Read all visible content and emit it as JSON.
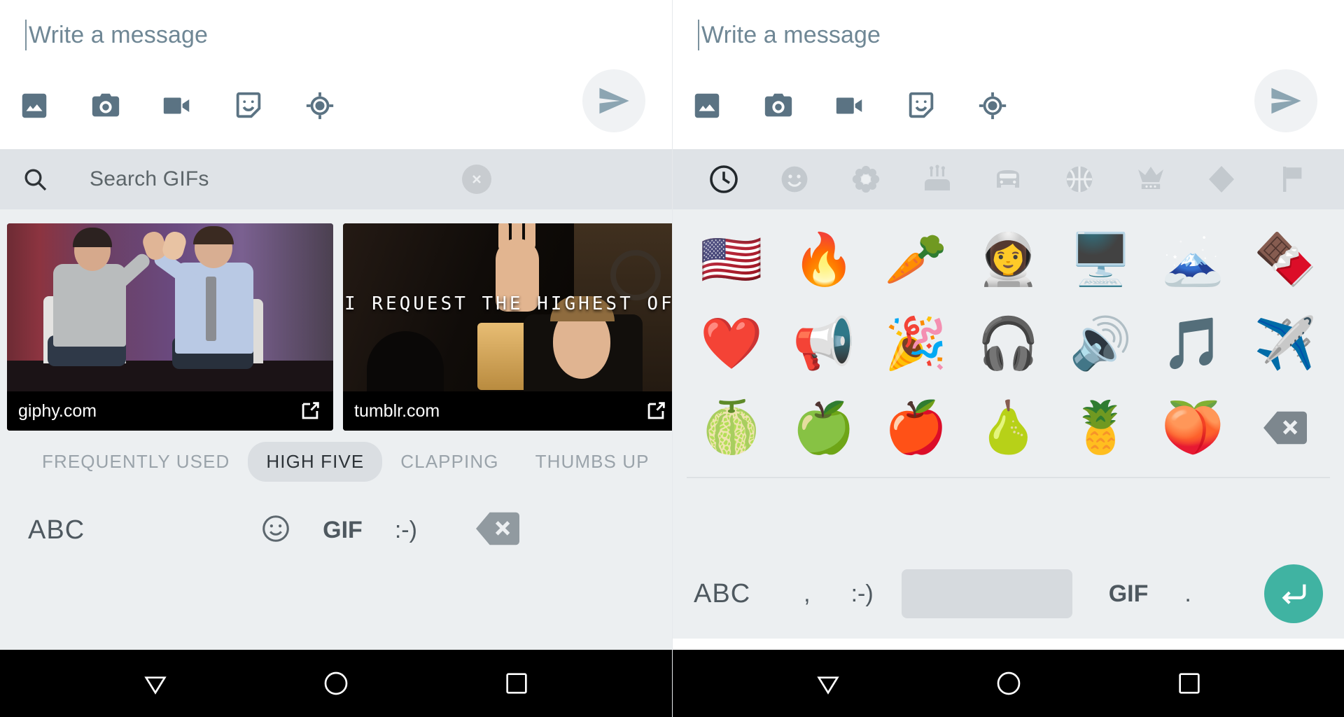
{
  "compose": {
    "placeholder": "Write a message",
    "actions": [
      {
        "name": "gallery-icon",
        "label": "Gallery"
      },
      {
        "name": "camera-icon",
        "label": "Camera"
      },
      {
        "name": "video-camera-icon",
        "label": "Video"
      },
      {
        "name": "sticker-icon",
        "label": "Sticker"
      },
      {
        "name": "location-icon",
        "label": "Location"
      }
    ],
    "send_label": "Send"
  },
  "gif_panel": {
    "search_placeholder": "Search GIFs",
    "clear_label": "Clear",
    "results": [
      {
        "source": "giphy.com",
        "caption": ""
      },
      {
        "source": "tumblr.com",
        "caption": "I REQUEST THE HIGHEST OF FIVES"
      }
    ],
    "categories": [
      {
        "label": "FREQUENTLY USED",
        "active": false
      },
      {
        "label": "HIGH FIVE",
        "active": true
      },
      {
        "label": "CLAPPING",
        "active": false
      },
      {
        "label": "THUMBS UP",
        "active": false
      }
    ]
  },
  "left_keyboard": {
    "abc_label": "ABC",
    "emoji_label": "emoji-face",
    "gif_label": "GIF",
    "kaomoji_label": ":-)",
    "backspace_label": "Backspace"
  },
  "emoji_panel": {
    "tabs": [
      {
        "name": "recent-clock-icon",
        "active": true
      },
      {
        "name": "smiley-icon",
        "active": false
      },
      {
        "name": "flower-icon",
        "active": false
      },
      {
        "name": "cake-icon",
        "active": false
      },
      {
        "name": "car-icon",
        "active": false
      },
      {
        "name": "basketball-icon",
        "active": false
      },
      {
        "name": "crown-icon",
        "active": false
      },
      {
        "name": "diamond-icon",
        "active": false
      },
      {
        "name": "flag-icon",
        "active": false
      }
    ],
    "emojis": [
      "🇺🇸",
      "🔥",
      "🥕",
      "👩‍🚀",
      "🖥️",
      "🗻",
      "🍫",
      "❤️",
      "📢",
      "🎉",
      "🎧",
      "🔊",
      "🎵",
      "✈️",
      "🍈",
      "🍏",
      "🍎",
      "🍐",
      "🍍",
      "🍑"
    ],
    "emoji_names": [
      "flag-united-states",
      "fire",
      "carrot",
      "astronaut",
      "desktop-computer",
      "mount-fuji",
      "chocolate-bar",
      "heart",
      "megaphone",
      "party-popper",
      "headphone",
      "speaker",
      "musical-note",
      "airplane",
      "melon",
      "green-apple",
      "red-apple",
      "pear",
      "pineapple",
      "peach"
    ],
    "backspace_label": "Backspace"
  },
  "right_keyboard": {
    "abc_label": "ABC",
    "comma_label": ",",
    "kaomoji_label": ":-)",
    "space_label": "",
    "gif_label": "GIF",
    "period_label": ".",
    "enter_label": "Enter"
  },
  "navbar": {
    "back_label": "Back",
    "home_label": "Home",
    "recents_label": "Recents"
  },
  "colors": {
    "icon_slate": "#5b7383",
    "panel_bg": "#eceff1",
    "bar_bg": "#dfe3e7",
    "accent_teal": "#40b3a2",
    "caption_bg": "#000000"
  }
}
